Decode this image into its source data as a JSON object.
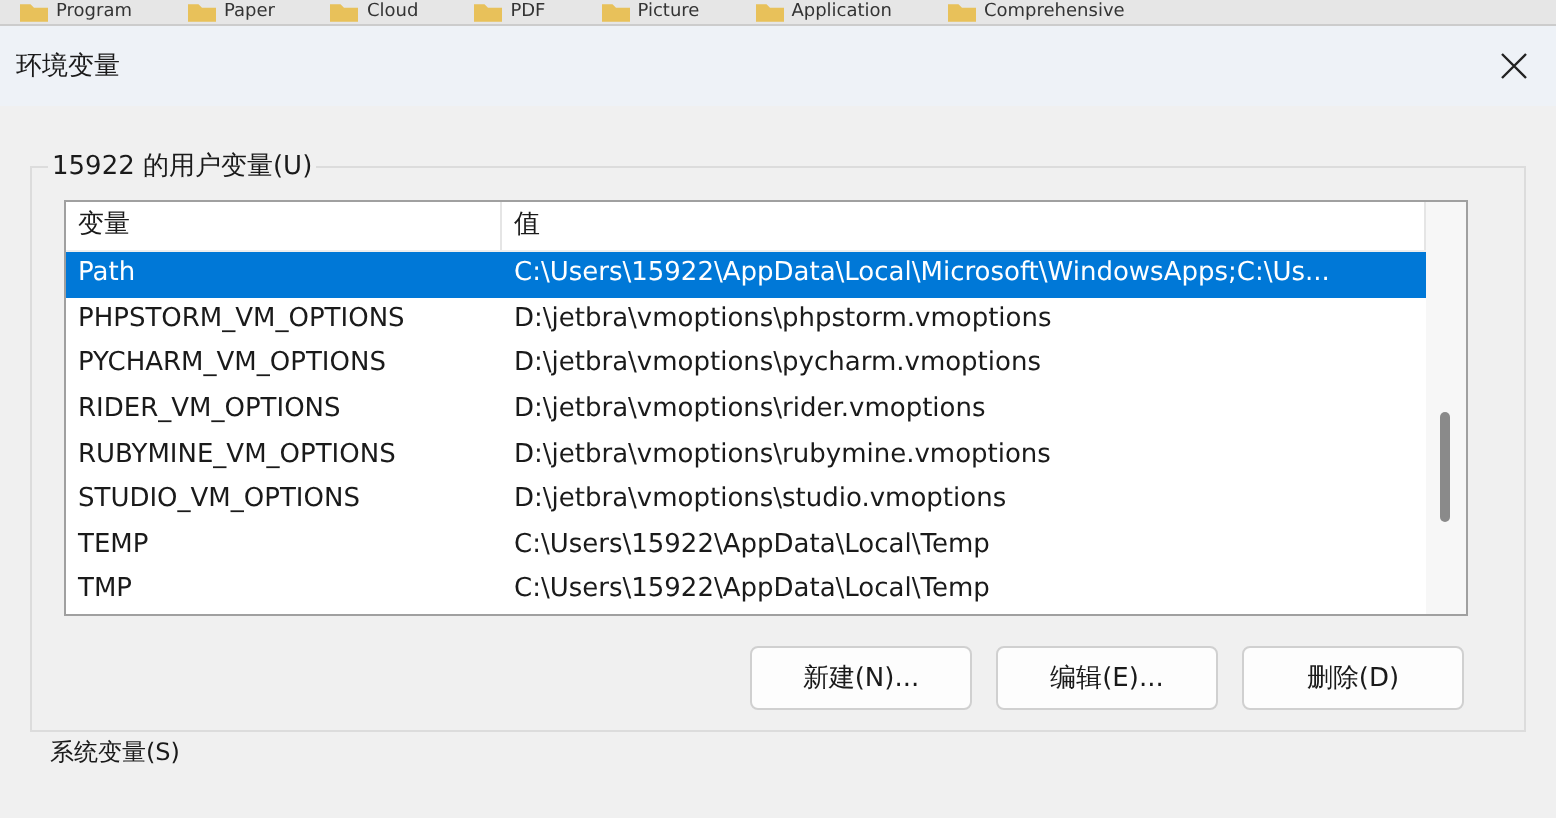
{
  "taskbar_folders": [
    "Program",
    "Paper",
    "Cloud",
    "PDF",
    "Picture",
    "Application",
    "Comprehensive"
  ],
  "window": {
    "title": "环境变量"
  },
  "user_variables": {
    "label": "15922 的用户变量(U)",
    "columns": [
      "变量",
      "值"
    ],
    "rows": [
      {
        "name": "Path",
        "value": "C:\\Users\\15922\\AppData\\Local\\Microsoft\\WindowsApps;C:\\Us...",
        "selected": true
      },
      {
        "name": "PHPSTORM_VM_OPTIONS",
        "value": "D:\\jetbra\\vmoptions\\phpstorm.vmoptions",
        "selected": false
      },
      {
        "name": "PYCHARM_VM_OPTIONS",
        "value": "D:\\jetbra\\vmoptions\\pycharm.vmoptions",
        "selected": false
      },
      {
        "name": "RIDER_VM_OPTIONS",
        "value": "D:\\jetbra\\vmoptions\\rider.vmoptions",
        "selected": false
      },
      {
        "name": "RUBYMINE_VM_OPTIONS",
        "value": "D:\\jetbra\\vmoptions\\rubymine.vmoptions",
        "selected": false
      },
      {
        "name": "STUDIO_VM_OPTIONS",
        "value": "D:\\jetbra\\vmoptions\\studio.vmoptions",
        "selected": false
      },
      {
        "name": "TEMP",
        "value": "C:\\Users\\15922\\AppData\\Local\\Temp",
        "selected": false
      },
      {
        "name": "TMP",
        "value": "C:\\Users\\15922\\AppData\\Local\\Temp",
        "selected": false
      }
    ],
    "buttons": [
      "新建(N)...",
      "编辑(E)...",
      "删除(D)"
    ]
  },
  "system_variables": {
    "label": "系统变量(S)"
  }
}
